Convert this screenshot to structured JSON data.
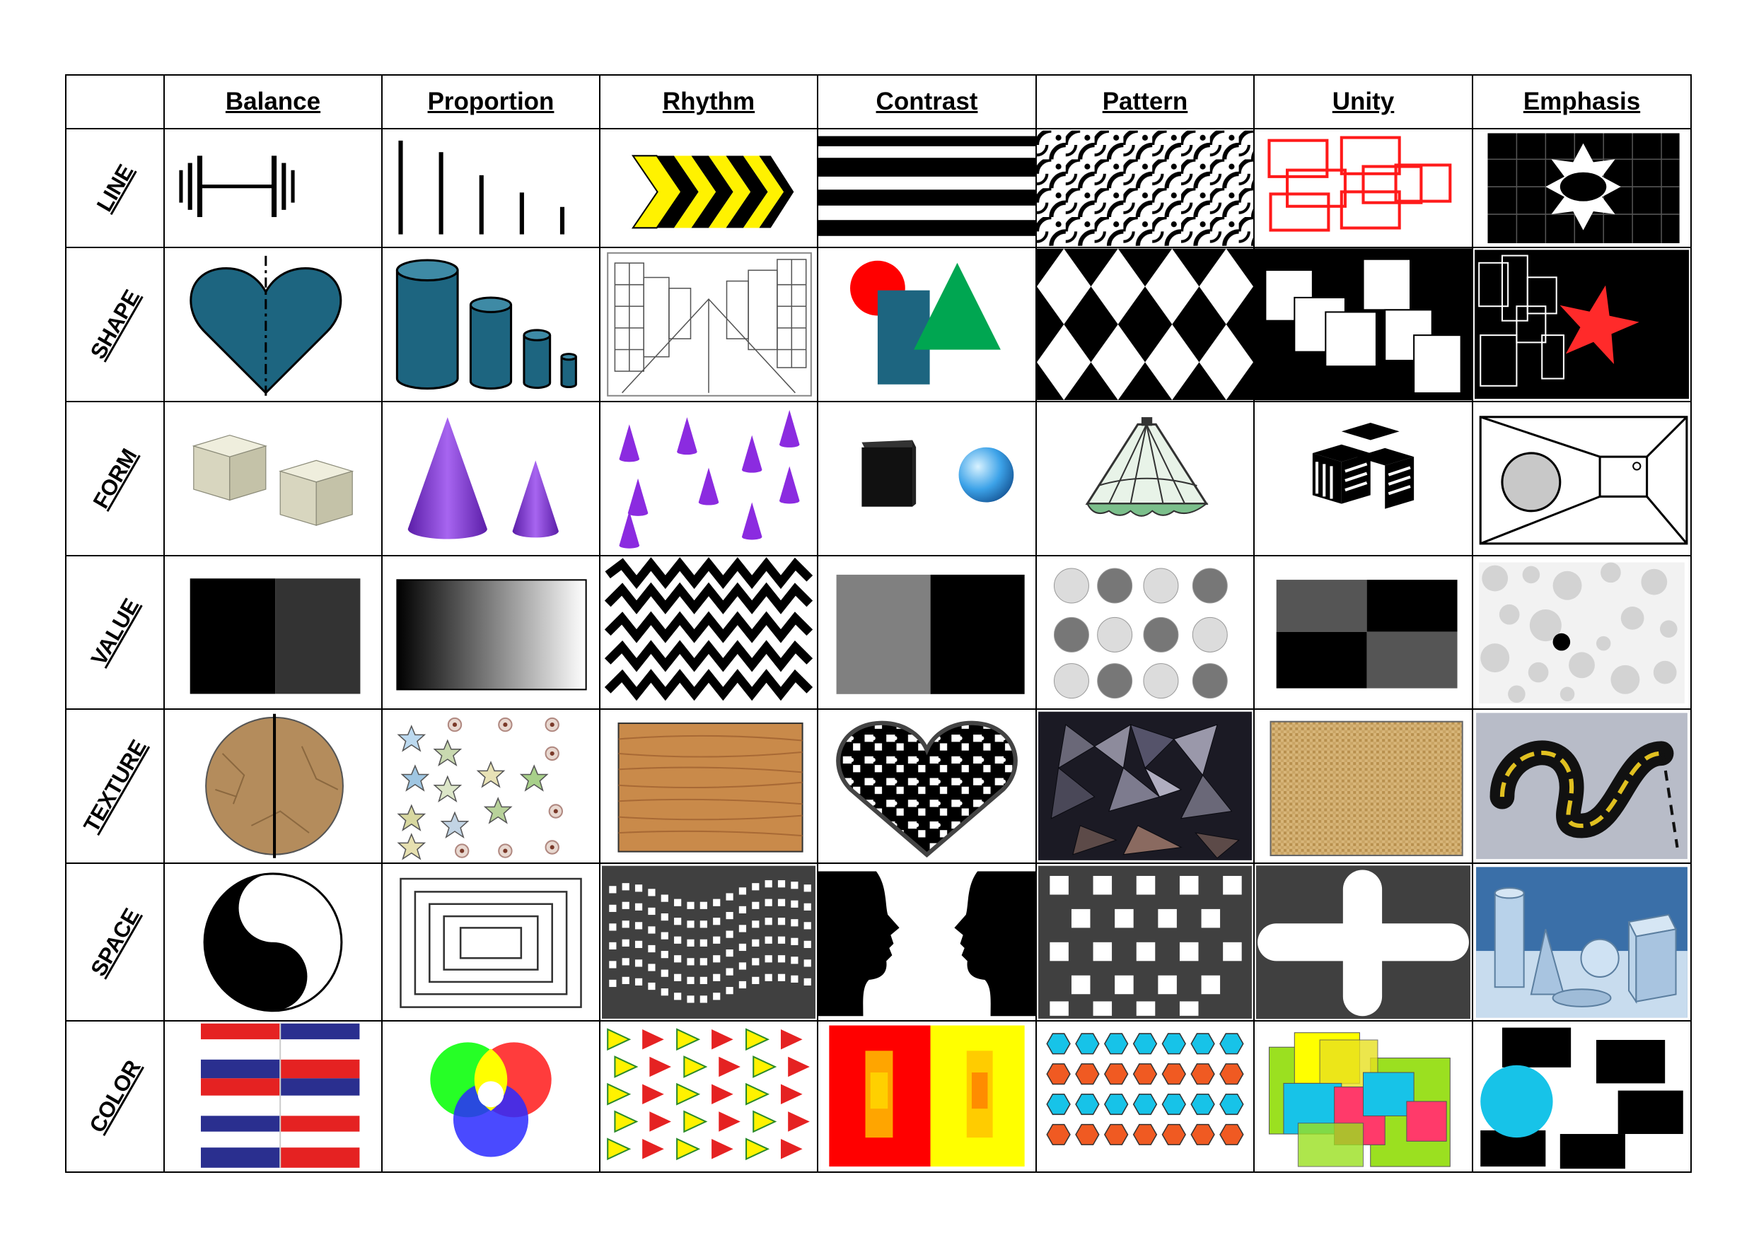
{
  "columns": [
    "Balance",
    "Proportion",
    "Rhythm",
    "Contrast",
    "Pattern",
    "Unity",
    "Emphasis"
  ],
  "rows": [
    "LINE",
    "SHAPE",
    "FORM",
    "VALUE",
    "TEXTURE",
    "SPACE",
    "COLOR"
  ],
  "colors": {
    "teal": "#1d6580",
    "yellow": "#fff200",
    "purple": "#8b2be0",
    "red": "#ff1a1a",
    "green": "#00a651",
    "cyan": "#17c3e8",
    "orange": "#f05a22"
  }
}
